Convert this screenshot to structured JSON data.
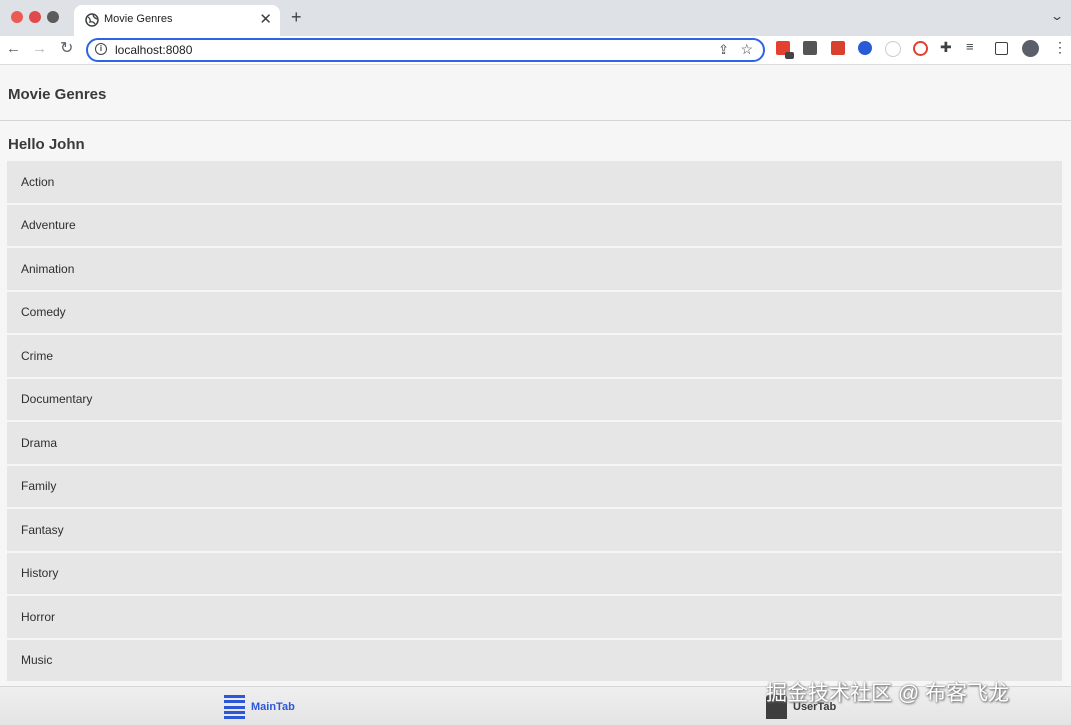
{
  "browser": {
    "tab_title": "Movie Genres",
    "new_tab_symbol": "+",
    "close_symbol": "✕",
    "url": "localhost:8080",
    "extension_icons": [
      "red-extension-icon",
      "dark-extension-icon",
      "red-square-extension-icon",
      "blue-dot-extension-icon",
      "panda-extension-icon",
      "red-circle-extension-icon",
      "puzzle-icon",
      "media-queue-icon",
      "side-panel-icon",
      "profile-avatar",
      "menu-dots-icon"
    ]
  },
  "app": {
    "title": "Movie Genres",
    "greeting": "Hello John",
    "genres": [
      "Action",
      "Adventure",
      "Animation",
      "Comedy",
      "Crime",
      "Documentary",
      "Drama",
      "Family",
      "Fantasy",
      "History",
      "Horror",
      "Music"
    ]
  },
  "tabbar": {
    "main_label": "MainTab",
    "user_label": "UserTab",
    "active": "MainTab",
    "active_color": "#2b57d8"
  },
  "watermark": "掘金技术社区 @ 布客飞龙"
}
